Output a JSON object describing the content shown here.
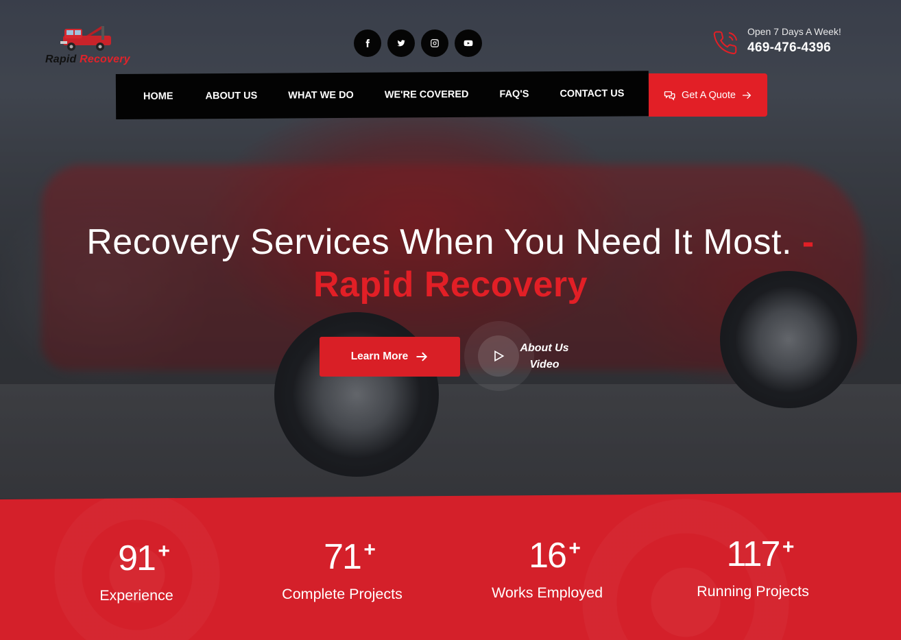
{
  "brand": {
    "logo_part1": "Rapid",
    "logo_part2": "Recovery",
    "accent_color": "#e21f26"
  },
  "social": [
    {
      "name": "facebook-icon"
    },
    {
      "name": "twitter-icon"
    },
    {
      "name": "instagram-icon"
    },
    {
      "name": "youtube-icon"
    }
  ],
  "contact": {
    "hours": "Open 7 Days A Week!",
    "phone": "469-476-4396",
    "icon": "phone-icon"
  },
  "nav": {
    "items": [
      "HOME",
      "ABOUT US",
      "WHAT WE DO",
      "WE'RE COVERED",
      "FAQ'S",
      "CONTACT US"
    ],
    "quote_label": "Get A Quote"
  },
  "hero": {
    "title_main": "Recovery Services When You Need It Most.",
    "title_accent": "- Rapid Recovery",
    "cta_label": "Learn More",
    "video_label_1": "About Us",
    "video_label_2": "Video"
  },
  "stats": [
    {
      "value": "91",
      "suffix": "+",
      "label": "Experience"
    },
    {
      "value": "71",
      "suffix": "+",
      "label": "Complete Projects"
    },
    {
      "value": "16",
      "suffix": "+",
      "label": "Works Employed"
    },
    {
      "value": "117",
      "suffix": "+",
      "label": "Running Projects"
    }
  ]
}
